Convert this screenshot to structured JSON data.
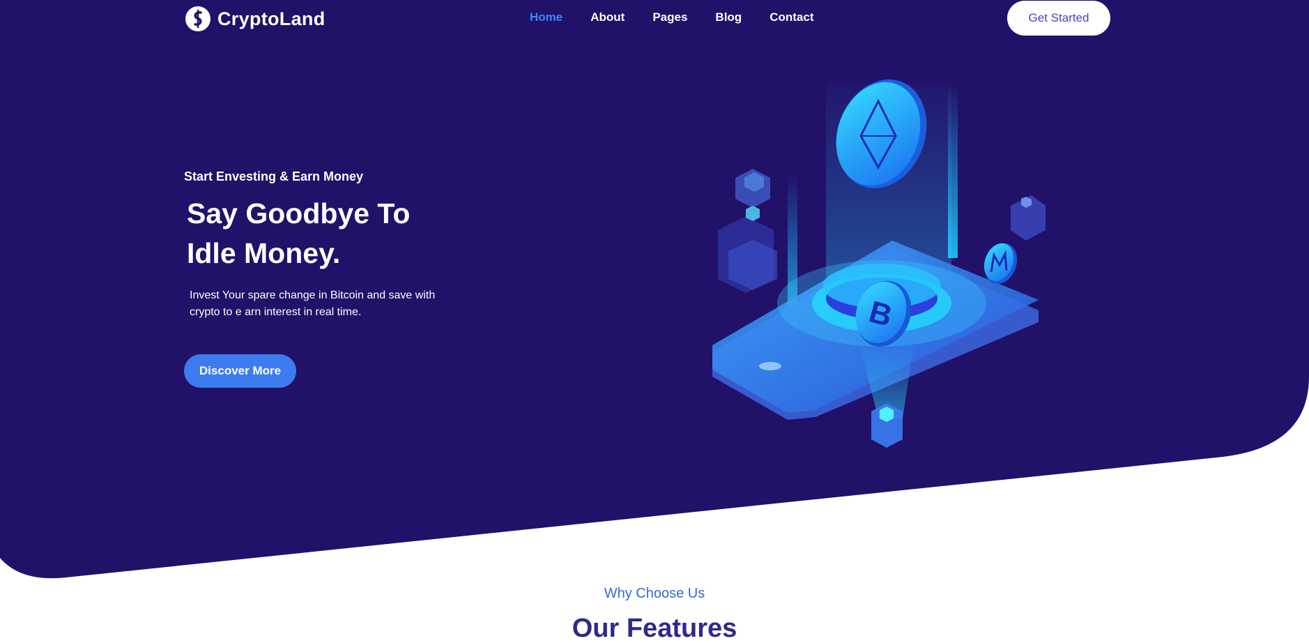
{
  "brand": {
    "name": "CryptoLand",
    "logo_icon": "dollar-coin-icon"
  },
  "colors": {
    "hero_bg": "#211169",
    "accent": "#3d86ff",
    "button": "#3d7bf0",
    "features_title": "#2c2a8c"
  },
  "nav": {
    "items": [
      {
        "label": "Home",
        "active": true
      },
      {
        "label": "About",
        "active": false
      },
      {
        "label": "Pages",
        "active": false
      },
      {
        "label": "Blog",
        "active": false
      },
      {
        "label": "Contact",
        "active": false
      }
    ],
    "cta_label": "Get Started"
  },
  "hero": {
    "eyebrow": "Start Envesting & Earn Money",
    "headline_line1": "Say Goodbye To",
    "headline_line2": "Idle Money.",
    "lead": "Invest Your spare change in Bitcoin and save with crypto to e arn interest in real time.",
    "button_label": "Discover More",
    "illustration": "isometric-crypto-phone-illustration"
  },
  "features": {
    "eyebrow": "Why Choose Us",
    "title": "Our Features"
  }
}
